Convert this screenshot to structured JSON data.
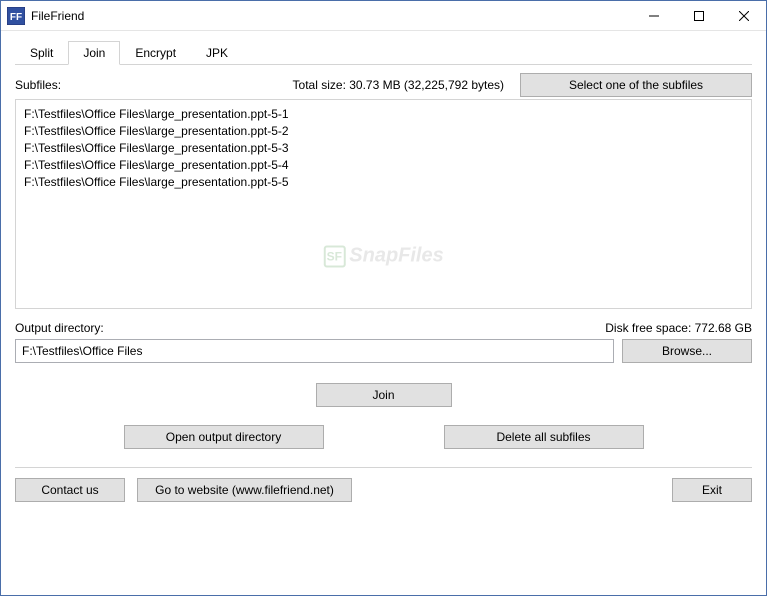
{
  "window": {
    "title": "FileFriend",
    "icon_label": "FF"
  },
  "tabs": [
    {
      "label": "Split",
      "active": false
    },
    {
      "label": "Join",
      "active": true
    },
    {
      "label": "Encrypt",
      "active": false
    },
    {
      "label": "JPK",
      "active": false
    }
  ],
  "subfiles": {
    "label": "Subfiles:",
    "total_size": "Total size: 30.73 MB (32,225,792 bytes)",
    "select_button": "Select one of the subfiles",
    "files": [
      "F:\\Testfiles\\Office Files\\large_presentation.ppt-5-1",
      "F:\\Testfiles\\Office Files\\large_presentation.ppt-5-2",
      "F:\\Testfiles\\Office Files\\large_presentation.ppt-5-3",
      "F:\\Testfiles\\Office Files\\large_presentation.ppt-5-4",
      "F:\\Testfiles\\Office Files\\large_presentation.ppt-5-5"
    ]
  },
  "watermark": {
    "text": "SnapFiles"
  },
  "output": {
    "label": "Output directory:",
    "disk_space": "Disk free space: 772.68 GB",
    "value": "F:\\Testfiles\\Office Files",
    "browse_button": "Browse..."
  },
  "actions": {
    "join": "Join",
    "open_output": "Open output directory",
    "delete_all": "Delete all subfiles"
  },
  "footer": {
    "contact": "Contact us",
    "website": "Go to website (www.filefriend.net)",
    "exit": "Exit"
  }
}
